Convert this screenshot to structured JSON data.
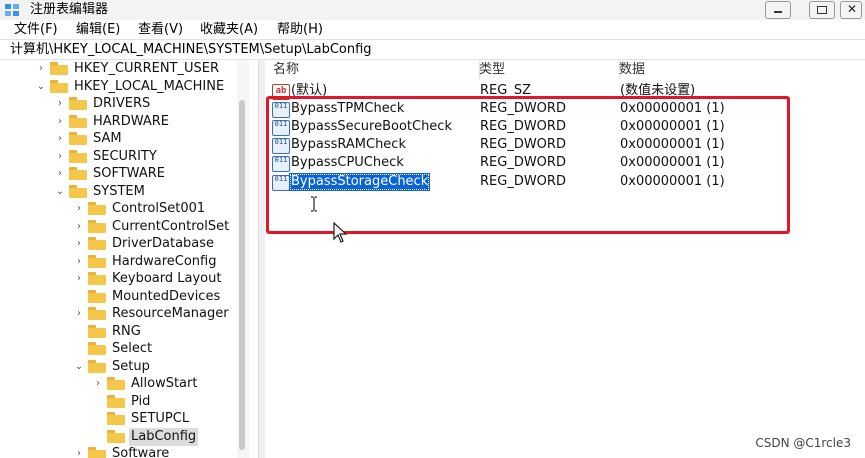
{
  "window": {
    "title": "注册表编辑器",
    "icon": "regedit-icon",
    "controls": [
      "minimize",
      "maximize",
      "close"
    ]
  },
  "menu": [
    "文件(F)",
    "编辑(E)",
    "查看(V)",
    "收藏夹(A)",
    "帮助(H)"
  ],
  "address": "计算机\\HKEY_LOCAL_MACHINE\\SYSTEM\\Setup\\LabConfig",
  "tree": [
    {
      "label": "HKEY_CURRENT_USER",
      "arrow": "›",
      "level": 0
    },
    {
      "label": "HKEY_LOCAL_MACHINE",
      "arrow": "⌄",
      "level": 0
    },
    {
      "label": "DRIVERS",
      "arrow": "›",
      "level": 1
    },
    {
      "label": "HARDWARE",
      "arrow": "›",
      "level": 1
    },
    {
      "label": "SAM",
      "arrow": "›",
      "level": 1
    },
    {
      "label": "SECURITY",
      "arrow": "›",
      "level": 1
    },
    {
      "label": "SOFTWARE",
      "arrow": "›",
      "level": 1
    },
    {
      "label": "SYSTEM",
      "arrow": "⌄",
      "level": 1
    },
    {
      "label": "ControlSet001",
      "arrow": "›",
      "level": 2
    },
    {
      "label": "CurrentControlSet",
      "arrow": "›",
      "level": 2
    },
    {
      "label": "DriverDatabase",
      "arrow": "›",
      "level": 2
    },
    {
      "label": "HardwareConfig",
      "arrow": "›",
      "level": 2
    },
    {
      "label": "Keyboard Layout",
      "arrow": "›",
      "level": 2
    },
    {
      "label": "MountedDevices",
      "arrow": "",
      "level": 2
    },
    {
      "label": "ResourceManager",
      "arrow": "›",
      "level": 2
    },
    {
      "label": "RNG",
      "arrow": "",
      "level": 2
    },
    {
      "label": "Select",
      "arrow": "",
      "level": 2
    },
    {
      "label": "Setup",
      "arrow": "⌄",
      "level": 2
    },
    {
      "label": "AllowStart",
      "arrow": "›",
      "level": 3
    },
    {
      "label": "Pid",
      "arrow": "",
      "level": 3
    },
    {
      "label": "SETUPCL",
      "arrow": "",
      "level": 3
    },
    {
      "label": "LabConfig",
      "arrow": "",
      "level": 3,
      "selected": true
    },
    {
      "label": "Software",
      "arrow": "›",
      "level": 2
    }
  ],
  "list": {
    "columns": [
      "名称",
      "类型",
      "数据"
    ],
    "rows": [
      {
        "name": "(默认)",
        "type": "REG_SZ",
        "data": "(数值未设置)",
        "icon": "string-value-icon",
        "icon_text": "ab"
      },
      {
        "name": "BypassTPMCheck",
        "type": "REG_DWORD",
        "data": "0x00000001 (1)",
        "icon": "binary-value-icon",
        "icon_text": "011"
      },
      {
        "name": "BypassSecureBootCheck",
        "type": "REG_DWORD",
        "data": "0x00000001 (1)",
        "icon": "binary-value-icon",
        "icon_text": "011"
      },
      {
        "name": "BypassRAMCheck",
        "type": "REG_DWORD",
        "data": "0x00000001 (1)",
        "icon": "binary-value-icon",
        "icon_text": "011"
      },
      {
        "name": "BypassCPUCheck",
        "type": "REG_DWORD",
        "data": "0x00000001 (1)",
        "icon": "binary-value-icon",
        "icon_text": "011"
      },
      {
        "name": "BypassStorageCheck",
        "type": "REG_DWORD",
        "data": "0x00000001 (1)",
        "icon": "binary-value-icon",
        "icon_text": "011",
        "selected": true
      }
    ]
  },
  "annotation": {
    "color": "#e3152b"
  },
  "watermark": "CSDN @C1rcle3",
  "colors": {
    "selection": "#0a64d6",
    "folder": "#f4c64a",
    "highlight_box": "#e3152b"
  }
}
